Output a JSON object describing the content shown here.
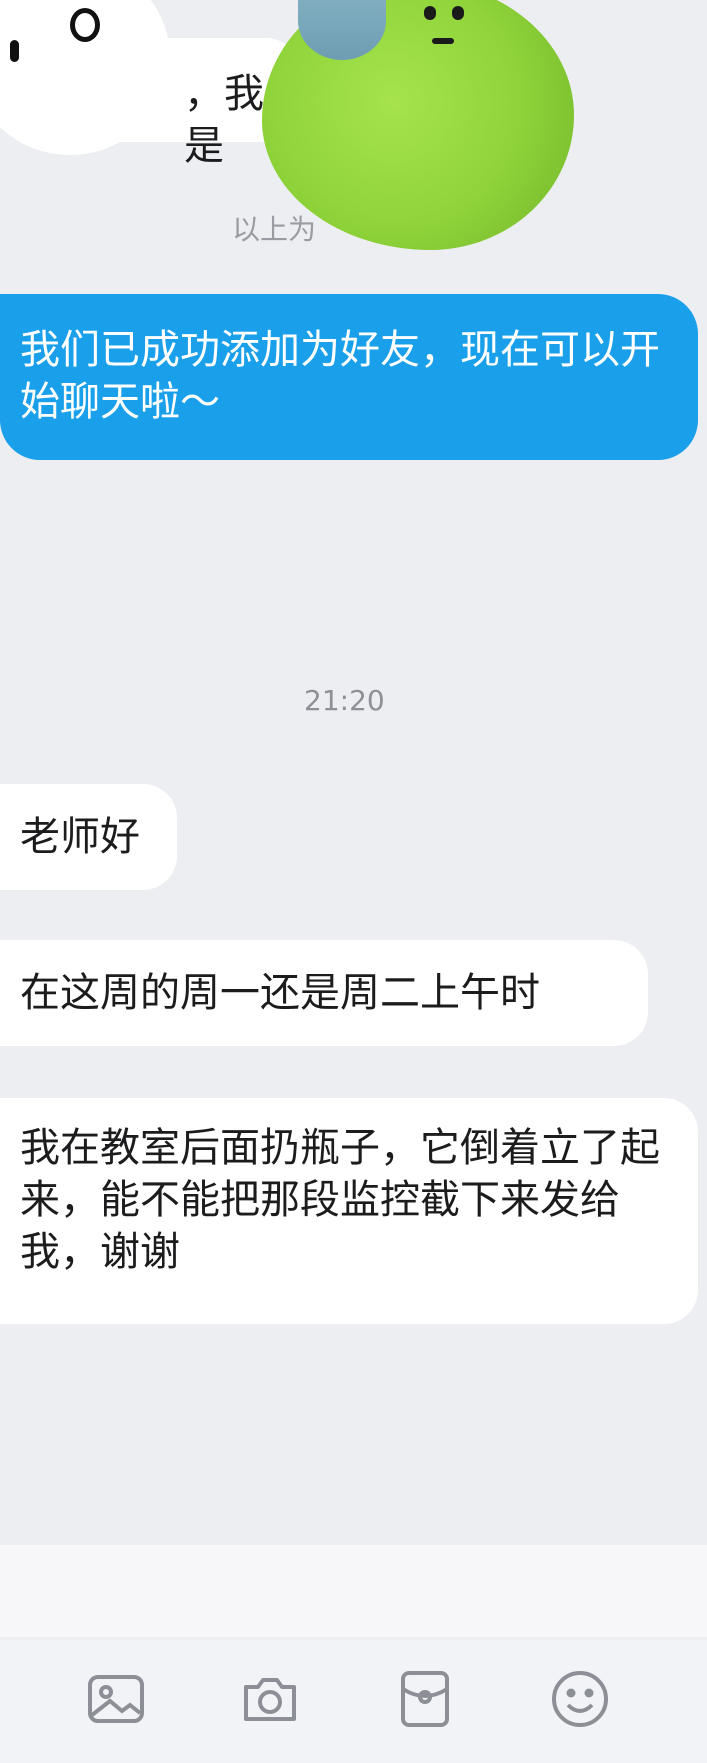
{
  "messages": {
    "top_partial": "，我是",
    "system_notice": "以上为",
    "sent": "我们已成功添加为好友，现在可以开始聊天啦～",
    "time": "21:20",
    "msg1": "老师好",
    "msg2": "在这周的周一还是周二上午时",
    "msg3": "我在教室后面扔瓶子，它倒着立了起来，能不能把那段监控截下来发给我，谢谢"
  },
  "toolbar": {
    "icons": [
      "image-icon",
      "camera-icon",
      "red-packet-icon",
      "emoji-icon"
    ]
  },
  "colors": {
    "background": "#edeef2",
    "sent_bubble": "#1aa0ea",
    "received_bubble": "#ffffff"
  }
}
